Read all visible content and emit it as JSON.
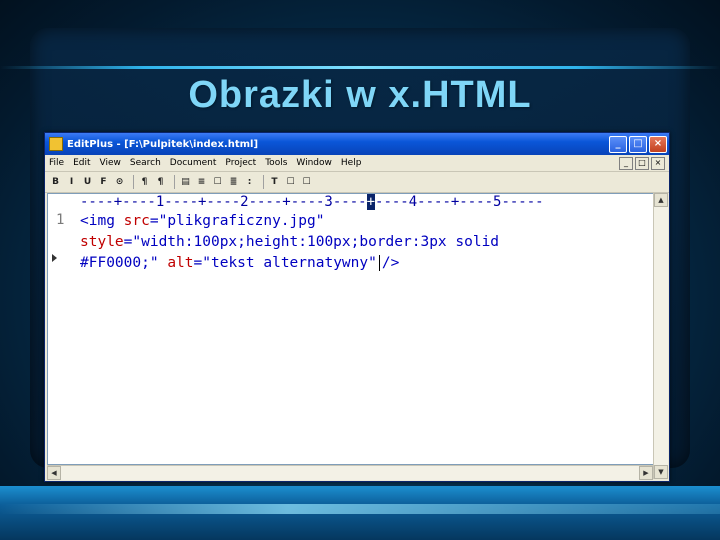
{
  "slide": {
    "title": "Obrazki w x.HTML"
  },
  "window": {
    "title": "EditPlus - [F:\\Pulpitek\\index.html]",
    "controls": {
      "minimize": "_",
      "maximize": "□",
      "close": "×"
    }
  },
  "menubar": {
    "items": [
      "File",
      "Edit",
      "View",
      "Search",
      "Document",
      "Project",
      "Tools",
      "Window",
      "Help"
    ]
  },
  "toolbar": {
    "buttons": [
      "B",
      "I",
      "U",
      "F",
      "⊙",
      "¶",
      "¶",
      "▤",
      "≡",
      "☐",
      "≣",
      ":",
      "T",
      "☐",
      "☐"
    ]
  },
  "ruler": {
    "text_before": "----+----1----+----2----+----3----",
    "cursor": "+",
    "text_after": "----4----+----5-----"
  },
  "editor": {
    "line_number": "1",
    "line1": {
      "tag_open": "<img",
      "attr1": "src",
      "eq1": "=",
      "val1": "\"plikgraficzny.jpg\""
    },
    "line2": {
      "attr": "style",
      "eq": "=",
      "val": "\"width:100px;height:100px;border:3px solid"
    },
    "line3": {
      "val_end": "#FF0000;\"",
      "attr": "alt",
      "eq": "=",
      "val": "\"tekst alternatywny\"",
      "tag_close": "/>"
    }
  },
  "colors": {
    "tag": "#0000c0",
    "attribute": "#c00000",
    "title_text": "#7fd6f7",
    "titlebar": "#0a56d8"
  }
}
